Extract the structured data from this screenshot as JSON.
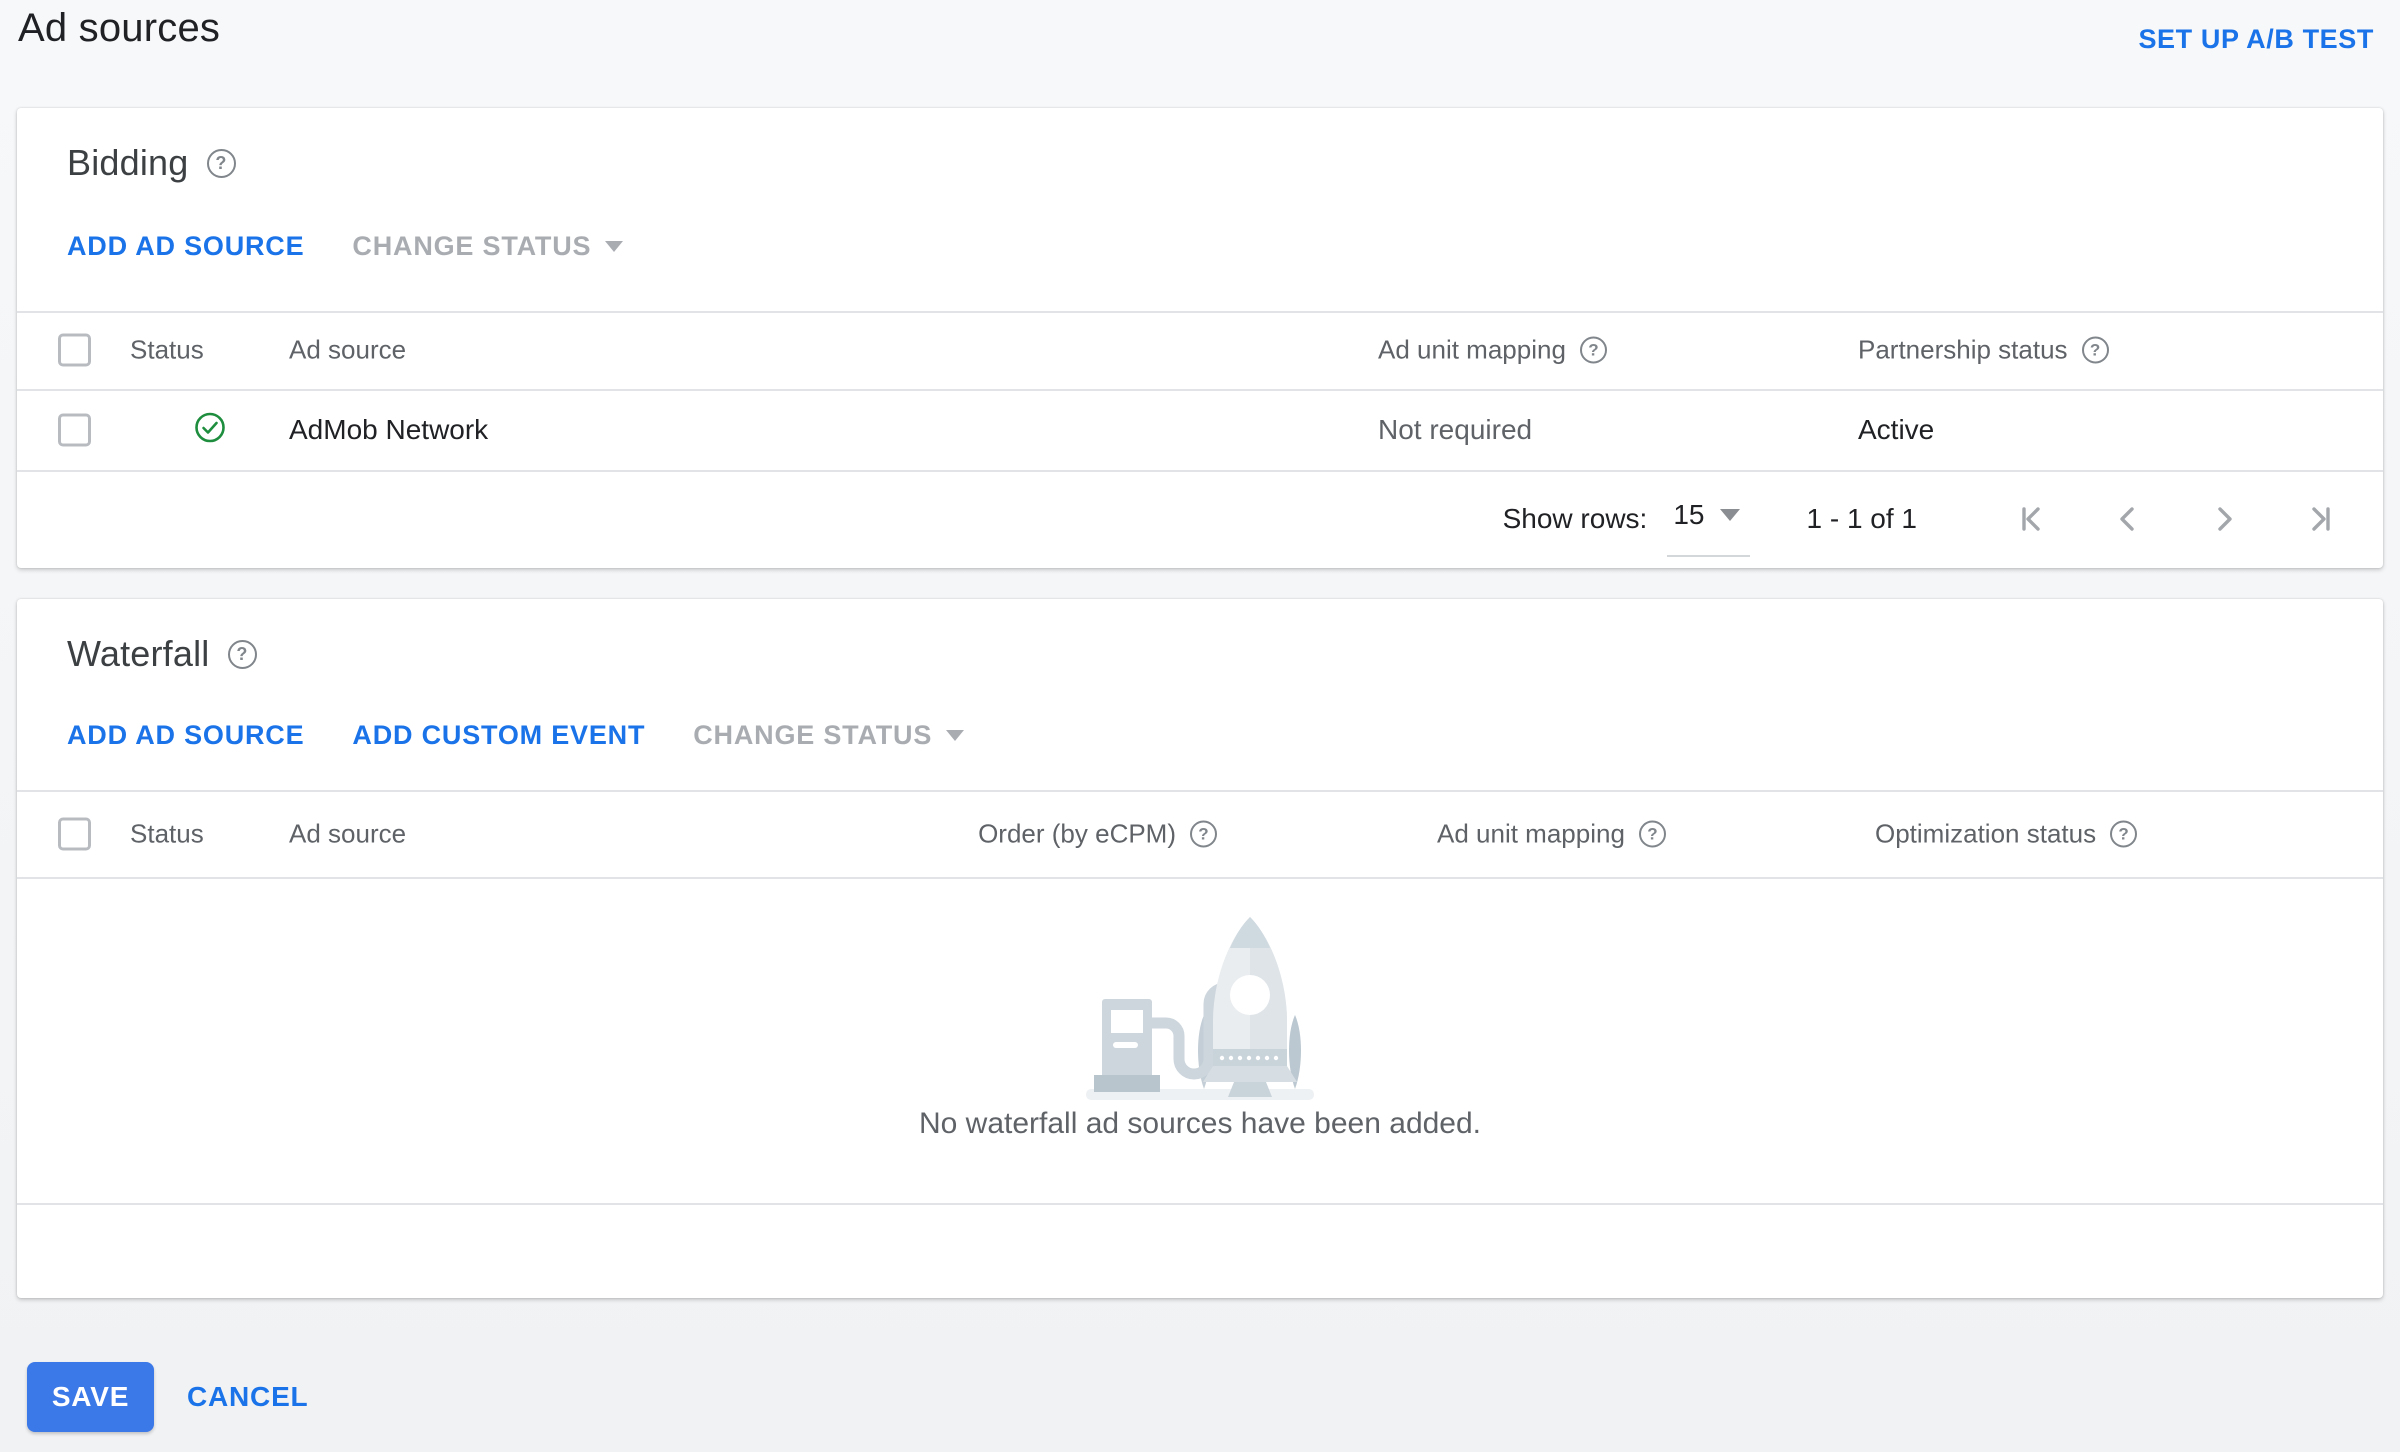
{
  "header": {
    "title": "Ad sources",
    "ab_test_link": "SET UP A/B TEST"
  },
  "bidding": {
    "title": "Bidding",
    "actions": {
      "add_ad_source": "ADD AD SOURCE",
      "change_status": "CHANGE STATUS"
    },
    "columns": {
      "status": "Status",
      "ad_source": "Ad source",
      "ad_unit_mapping": "Ad unit mapping",
      "partnership_status": "Partnership status"
    },
    "rows": [
      {
        "status_icon": "check-circle-green",
        "ad_source": "AdMob Network",
        "ad_unit_mapping": "Not required",
        "partnership_status": "Active"
      }
    ],
    "pagination": {
      "show_rows_label": "Show rows:",
      "rows_per_page": "15",
      "range": "1 - 1 of 1"
    }
  },
  "waterfall": {
    "title": "Waterfall",
    "actions": {
      "add_ad_source": "ADD AD SOURCE",
      "add_custom_event": "ADD CUSTOM EVENT",
      "change_status": "CHANGE STATUS"
    },
    "columns": {
      "status": "Status",
      "ad_source": "Ad source",
      "order": "Order (by eCPM)",
      "ad_unit_mapping": "Ad unit mapping",
      "optimization_status": "Optimization status"
    },
    "empty_state": {
      "illustration": "rocket-refueling",
      "message": "No waterfall ad sources have been added."
    }
  },
  "footer": {
    "save": "SAVE",
    "cancel": "CANCEL"
  },
  "icons": {
    "help": "?"
  },
  "colors": {
    "link_blue": "#1a73e8",
    "save_button_blue": "#3b78e8",
    "success_green": "#1e8e3e",
    "disabled_gray": "#a9adb2"
  }
}
